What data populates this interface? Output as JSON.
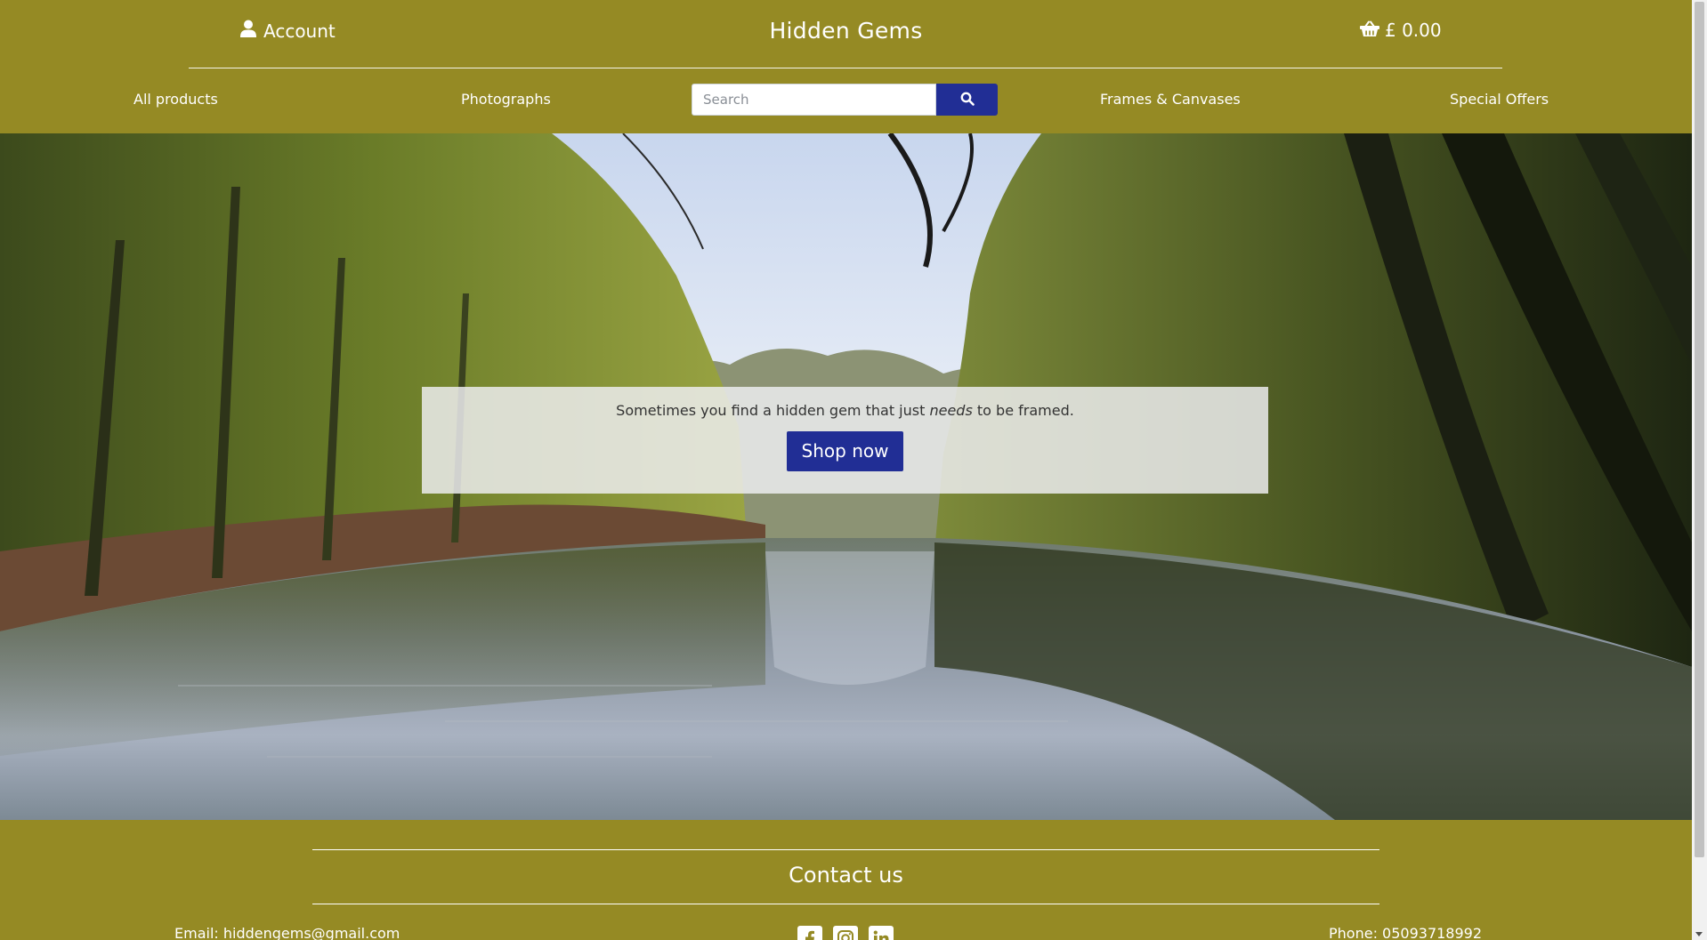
{
  "header": {
    "account_label": "Account",
    "brand": "Hidden Gems",
    "basket_total": "£ 0.00"
  },
  "nav": {
    "items": [
      {
        "label": "All products"
      },
      {
        "label": "Photographs"
      },
      {
        "label": "Frames & Canvases"
      },
      {
        "label": "Special Offers"
      }
    ],
    "search": {
      "placeholder": "Search",
      "value": ""
    }
  },
  "hero": {
    "tagline_before": "Sometimes you find a hidden gem that just",
    "tagline_emphasis": "needs",
    "tagline_after": "to be framed.",
    "button_label": "Shop now"
  },
  "footer": {
    "heading": "Contact us",
    "email": "Email: hiddengems@gmail.com",
    "phone": "Phone: 05093718992",
    "socials": [
      "facebook-icon",
      "instagram-icon",
      "linkedin-icon"
    ]
  },
  "colors": {
    "brand_olive": "#958a24",
    "button_blue": "#212e95",
    "panel": "#eeeef1"
  }
}
